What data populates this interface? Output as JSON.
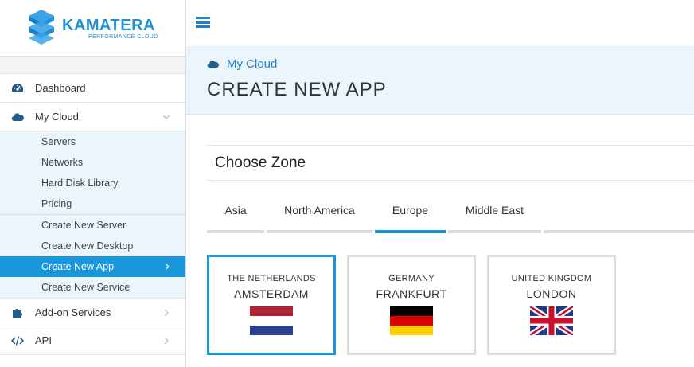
{
  "brand": {
    "name": "KAMATERA",
    "tagline": "PERFORMANCE CLOUD",
    "color": "#1f8fd6"
  },
  "sidebar": {
    "items": [
      {
        "label": "Dashboard",
        "icon": "dashboard-gauge-icon"
      },
      {
        "label": "My Cloud",
        "icon": "cloud-icon",
        "expanded": true
      },
      {
        "label": "Add-on Services",
        "icon": "puzzle-icon"
      },
      {
        "label": "API",
        "icon": "code-icon"
      }
    ],
    "cloud_sub_group_1": [
      "Servers",
      "Networks",
      "Hard Disk Library",
      "Pricing"
    ],
    "cloud_sub_group_2": [
      "Create New Server",
      "Create New Desktop",
      "Create New App",
      "Create New Service"
    ],
    "active_item": "Create New App",
    "accent": "#1a96dd"
  },
  "topbar": {
    "menu_icon": "hamburger-menu-icon"
  },
  "header": {
    "breadcrumb": "My Cloud",
    "title": "CREATE NEW APP"
  },
  "zone": {
    "title": "Choose Zone",
    "tabs": [
      "Asia",
      "North America",
      "Europe",
      "Middle East"
    ],
    "active_tab": "Europe",
    "cities": [
      {
        "country": "THE NETHERLANDS",
        "city": "AMSTERDAM",
        "flag": "netherlands-flag-icon",
        "selected": true
      },
      {
        "country": "GERMANY",
        "city": "FRANKFURT",
        "flag": "germany-flag-icon",
        "selected": false
      },
      {
        "country": "UNITED KINGDOM",
        "city": "LONDON",
        "flag": "uk-flag-icon",
        "selected": false
      }
    ]
  }
}
